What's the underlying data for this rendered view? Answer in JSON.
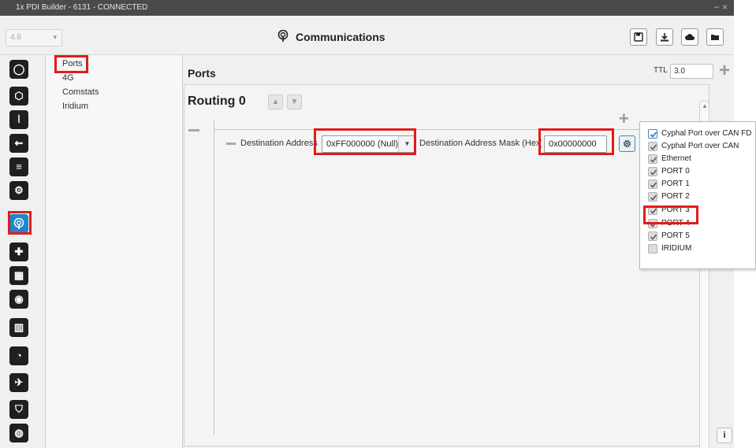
{
  "window": {
    "title": "1x PDI Builder - 6131 - CONNECTED",
    "controls": "− ×"
  },
  "toolbar": {
    "version": "4.8",
    "page_title": "Communications",
    "buttons": [
      "save-icon",
      "download-icon",
      "cloud-icon",
      "folder-icon"
    ]
  },
  "rail": {
    "items": [
      "power-icon",
      "chip-icon",
      "signal-icon",
      "usb-icon",
      "sliders-icon",
      "gears-icon",
      "communications-icon",
      "gamepad-icon",
      "grid-icon",
      "camera-icon",
      "chart-icon",
      "gauge-icon",
      "plane-icon",
      "shield-icon",
      "globe-icon"
    ],
    "active": "communications-icon"
  },
  "subnav": {
    "items": [
      "Ports",
      "4G",
      "Comstats",
      "Iridium"
    ],
    "selected": "Ports"
  },
  "main": {
    "section_title": "Ports",
    "ttl_label": "TTL",
    "ttl_value": "3.0",
    "routing_title": "Routing 0",
    "dest_address_label": "Destination Address",
    "dest_address_value": "0xFF000000 (Null)",
    "dest_mask_label": "Destination Address Mask (Hex)",
    "dest_mask_value": "0x00000000",
    "info_label": "i"
  },
  "ports_menu": [
    {
      "label": "Cyphal Port over CAN FD",
      "checked": true
    },
    {
      "label": "Cyphal Port over CAN",
      "checked": true
    },
    {
      "label": "Ethernet",
      "checked": true
    },
    {
      "label": "PORT 0",
      "checked": true
    },
    {
      "label": "PORT 1",
      "checked": true
    },
    {
      "label": "PORT 2",
      "checked": true
    },
    {
      "label": "PORT 3",
      "checked": true
    },
    {
      "label": "PORT 4",
      "checked": true
    },
    {
      "label": "PORT 5",
      "checked": true
    },
    {
      "label": "IRIDIUM",
      "checked": false
    }
  ],
  "colors": {
    "highlight": "#e21b1b",
    "accent": "#1a88c9",
    "titlebar": "#4a4a4a"
  }
}
